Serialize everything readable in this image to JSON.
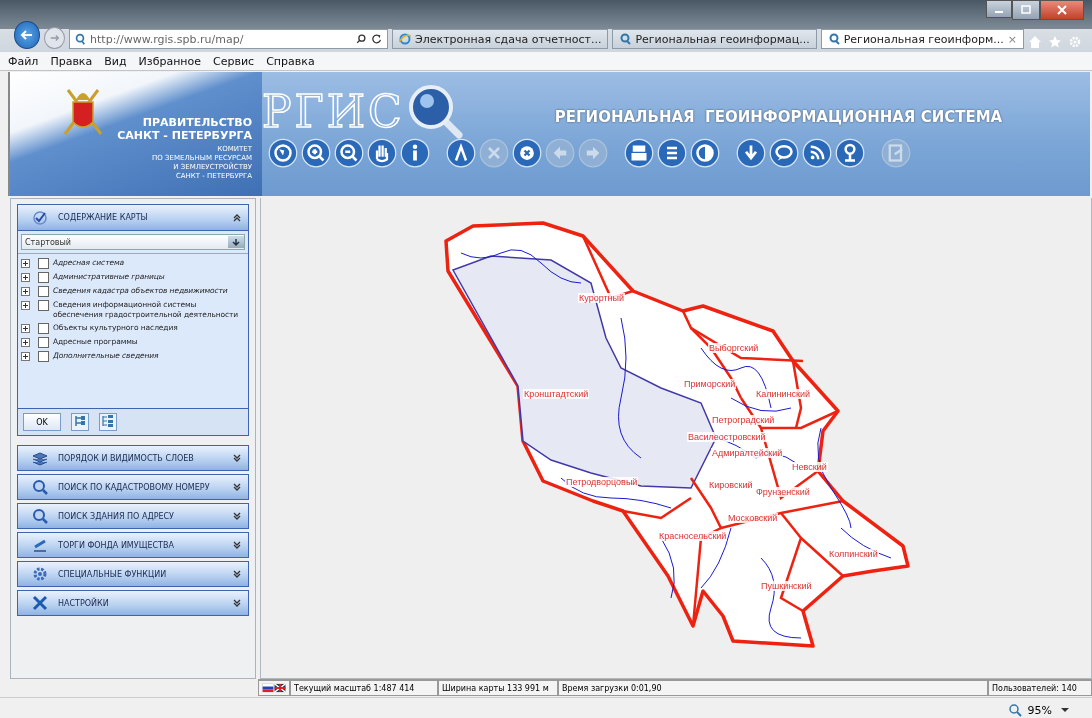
{
  "browser": {
    "address": "http://www.rgis.spb.ru/map/",
    "tabs": [
      {
        "label": "Электронная сдача отчетност...",
        "selected": false
      },
      {
        "label": "Региональная геоинформац...",
        "selected": false
      },
      {
        "label": "Региональная геоинформ...",
        "selected": true,
        "close": "×"
      }
    ],
    "menu": [
      "Файл",
      "Правка",
      "Вид",
      "Избранное",
      "Сервис",
      "Справка"
    ],
    "zoom": "95%"
  },
  "header": {
    "gov_lines": [
      "ПРАВИТЕЛЬСТВО",
      "САНКТ - ПЕТЕРБУРГА"
    ],
    "committee_lines": [
      "КОМИТЕТ",
      "ПО ЗЕМЕЛЬНЫМ РЕСУРСАМ",
      "И ЗЕМЛЕУСТРОЙСТВУ",
      "САНКТ - ПЕТЕРБУРГА"
    ],
    "logo": "РГИС",
    "title": "РЕГИОНАЛЬНАЯ  ГЕОИНФОРМАЦИОННАЯ СИСТЕМА"
  },
  "toolbar": [
    [
      {
        "disabled": false
      },
      {
        "disabled": false
      },
      {
        "disabled": false
      },
      {
        "disabled": false
      },
      {
        "disabled": false
      }
    ],
    [
      {
        "disabled": false
      },
      {
        "disabled": true
      },
      {
        "disabled": false
      },
      {
        "disabled": true
      },
      {
        "disabled": true
      }
    ],
    [
      {
        "disabled": false
      },
      {
        "disabled": false
      },
      {
        "disabled": false
      }
    ],
    [
      {
        "disabled": false
      },
      {
        "disabled": false
      },
      {
        "disabled": false
      },
      {
        "disabled": false
      }
    ],
    [
      {
        "disabled": true
      }
    ]
  ],
  "panel": {
    "open_section": {
      "title": "СОДЕРЖАНИЕ КАРТЫ",
      "expanded": true,
      "preset": "Стартовый",
      "layers": [
        {
          "label": "Адресная система",
          "checked": false,
          "italic": true
        },
        {
          "label": "Административные границы",
          "checked": false,
          "italic": true
        },
        {
          "label": "Сведения кадастра объектов недвижимости",
          "checked": false,
          "italic": true
        },
        {
          "label": "Сведения информационной системы обеспечения градостроительной деятельности",
          "checked": false,
          "italic": false
        },
        {
          "label": "Объекты культурного наследия",
          "checked": false,
          "italic": false
        },
        {
          "label": "Адресные программы",
          "checked": false,
          "italic": false
        },
        {
          "label": "Дополнительные сведения",
          "checked": false,
          "italic": true
        }
      ],
      "ok": "OK"
    },
    "sections": [
      {
        "title": "ПОРЯДОК И ВИДИМОСТЬ СЛОЕВ",
        "expanded": false
      },
      {
        "title": "ПОИСК ПО КАДАСТРОВОМУ НОМЕРУ",
        "expanded": false
      },
      {
        "title": "ПОИСК ЗДАНИЯ ПО АДРЕСУ",
        "expanded": false
      },
      {
        "title": "ТОРГИ ФОНДА ИМУЩЕСТВА",
        "expanded": false
      },
      {
        "title": "СПЕЦИАЛЬНЫЕ ФУНКЦИИ",
        "expanded": false
      },
      {
        "title": "НАСТРОЙКИ",
        "expanded": false
      }
    ]
  },
  "map": {
    "districts": [
      "Курортный",
      "Выборгский",
      "Приморский",
      "Кронштадтский",
      "Калининский",
      "Петроградский",
      "Василеостровский",
      "Адмиралтейский",
      "Невский",
      "Петродворцовый",
      "Кировский",
      "Фрунзенский",
      "Московский",
      "Красносельский",
      "Колпинский",
      "Пушкинский"
    ]
  },
  "status_bar": {
    "scale": "Текущий масштаб 1:487 414",
    "width": "Ширина карты 133 991 м",
    "load_time": "Время загрузки 0:01,90",
    "users": "Пользователей: 140"
  }
}
